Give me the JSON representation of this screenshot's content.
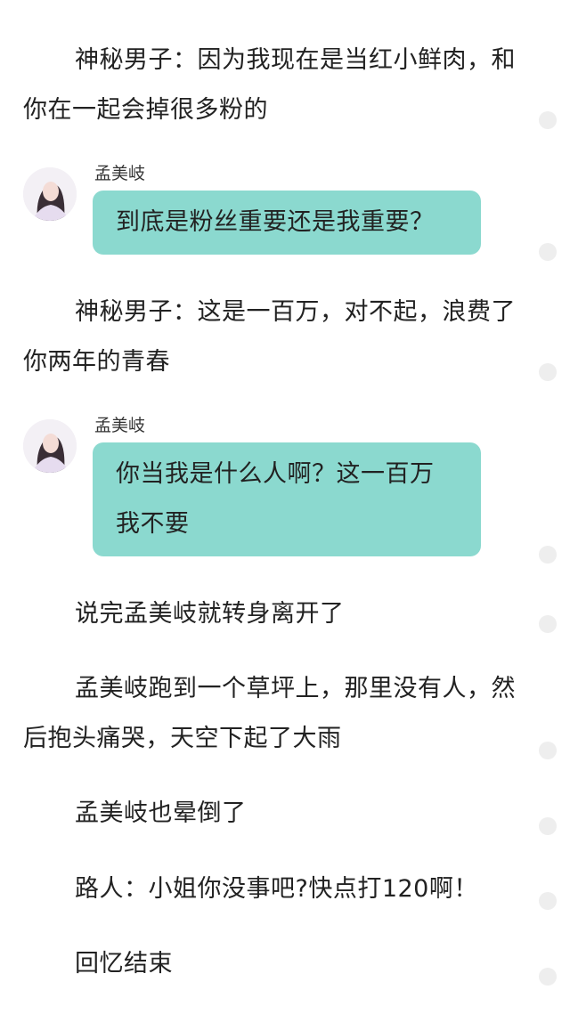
{
  "paragraphs": [
    "神秘男子：因为我现在是当红小鲜肉，和你在一起会掉很多粉的",
    "神秘男子：这是一百万，对不起，浪费了你两年的青春",
    "说完孟美岐就转身离开了",
    "孟美岐跑到一个草坪上，那里没有人，然后抱头痛哭，天空下起了大雨",
    "孟美岐也晕倒了",
    "路人：小姐你没事吧?快点打120啊！",
    "回忆结束"
  ],
  "chats": [
    {
      "speaker": "孟美岐",
      "text": "到底是粉丝重要还是我重要？",
      "avatar": "user-avatar"
    },
    {
      "speaker": "孟美岐",
      "text": "你当我是什么人啊？这一百万我不要",
      "avatar": "user-avatar"
    }
  ],
  "colors": {
    "bubble": "#8bd9cf",
    "text": "#222222",
    "dot": "#eeeeee"
  }
}
